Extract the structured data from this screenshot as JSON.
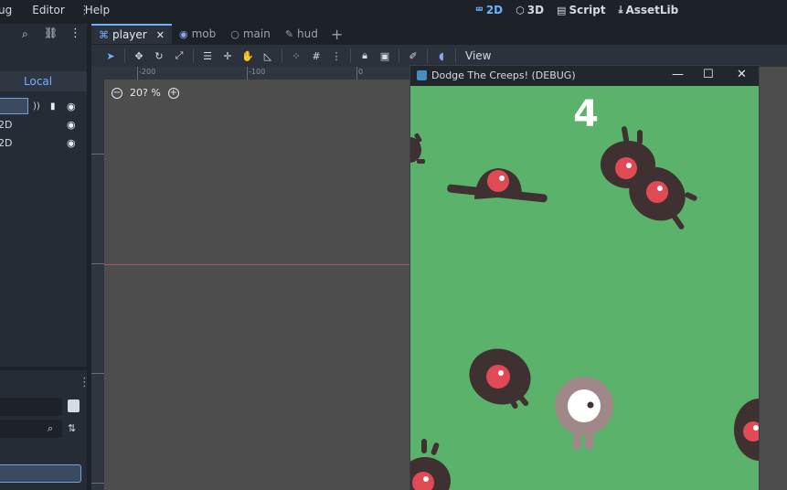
{
  "menu": {
    "items": [
      "ug",
      "Editor",
      "Help"
    ]
  },
  "main_screens": [
    {
      "icon": "2d-icon",
      "label": "2D",
      "active": true
    },
    {
      "icon": "3d-icon",
      "label": "3D",
      "active": false
    },
    {
      "icon": "script-icon",
      "label": "Script",
      "active": false
    },
    {
      "icon": "assetlib-icon",
      "label": "AssetLib",
      "active": false
    }
  ],
  "scene_dock": {
    "local_label": "Local",
    "tree": [
      {
        "label": "",
        "selected": true
      },
      {
        "label": "2D",
        "selected": false
      },
      {
        "label": "2D",
        "selected": false
      }
    ]
  },
  "tabs": [
    {
      "label": "player",
      "icon": "node2d-icon",
      "active": true
    },
    {
      "label": "mob",
      "icon": "rigidbody-icon",
      "active": false
    },
    {
      "label": "main",
      "icon": "node-icon",
      "active": false
    },
    {
      "label": "hud",
      "icon": "canvaslayer-icon",
      "active": false
    }
  ],
  "toolbar": {
    "view_label": "View"
  },
  "viewport": {
    "zoom_label": "20? %",
    "ruler_labels": [
      "-200",
      "-100",
      "0"
    ]
  },
  "game_window": {
    "title": "Dodge The Creeps! (DEBUG)",
    "score": "4",
    "colors": {
      "background": "#5bb26a",
      "mob": "#3f3131",
      "eye": "#e04a55",
      "player": "#a08888"
    }
  }
}
